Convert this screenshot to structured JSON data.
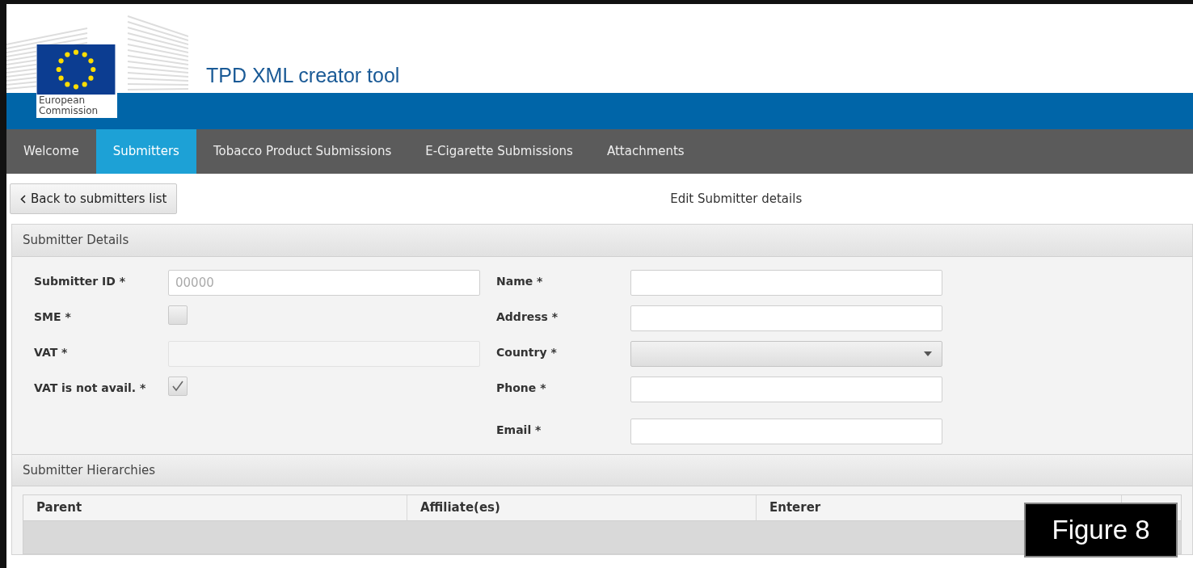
{
  "header": {
    "logo_text": [
      "European",
      "Commission"
    ],
    "title": "TPD XML creator tool"
  },
  "nav": [
    {
      "label": "Welcome",
      "selected": false
    },
    {
      "label": "Submitters",
      "selected": true
    },
    {
      "label": "Tobacco Product Submissions",
      "selected": false
    },
    {
      "label": "E-Cigarette Submissions",
      "selected": false
    },
    {
      "label": "Attachments",
      "selected": false
    }
  ],
  "toolbar": {
    "back_button": "Back to submitters list",
    "page_title": "Edit Submitter details"
  },
  "details": {
    "title": "Submitter Details",
    "left_fields": [
      {
        "kind": "text",
        "label": "Submitter ID *",
        "placeholder": "00000",
        "disabled": false
      },
      {
        "kind": "checkbox",
        "label": "SME *",
        "checked": false
      },
      {
        "kind": "text",
        "label": "VAT *",
        "disabled": true
      },
      {
        "kind": "checkbox",
        "label": "VAT is not avail. *",
        "checked": true
      }
    ],
    "right_fields": [
      {
        "kind": "text",
        "label": "Name *",
        "disabled": false
      },
      {
        "kind": "text",
        "label": "Address *",
        "disabled": false
      },
      {
        "kind": "select",
        "label": "Country *"
      },
      {
        "kind": "text",
        "label": "Phone *",
        "disabled": false
      },
      {
        "kind": "text",
        "label": "Email *",
        "disabled": false
      }
    ]
  },
  "hierarchies": {
    "title": "Submitter Hierarchies",
    "columns": [
      "Parent",
      "Affiliate(es)",
      "Enterer"
    ]
  },
  "figure_label": "Figure 8"
}
